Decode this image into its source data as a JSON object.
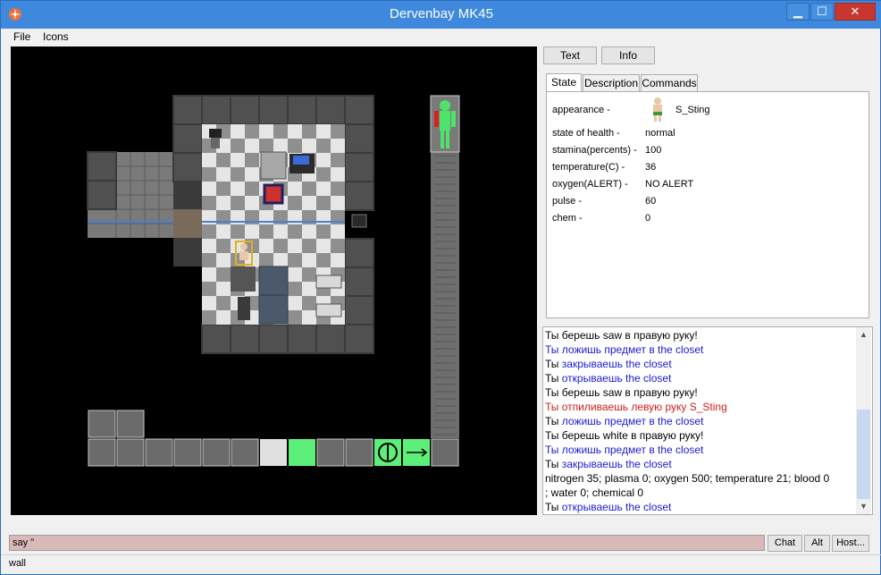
{
  "window": {
    "title": "Dervenbay MK45"
  },
  "menu": {
    "file": "File",
    "icons": "Icons"
  },
  "buttons": {
    "text": "Text",
    "info": "Info"
  },
  "tabs": [
    "State",
    "Description",
    "Commands"
  ],
  "state": {
    "rows": [
      {
        "label": "appearance -",
        "value": "S_Sting"
      },
      {
        "label": "state of health -",
        "value": "normal"
      },
      {
        "label": "stamina(percents) -",
        "value": "100"
      },
      {
        "label": "temperature(C) -",
        "value": "36"
      },
      {
        "label": "oxygen(ALERT) -",
        "value": "NO ALERT"
      },
      {
        "label": "pulse -",
        "value": "60"
      },
      {
        "label": "chem -",
        "value": "0"
      }
    ]
  },
  "chat": {
    "lines": [
      {
        "prefix": "Ты",
        "text": " берешь saw в правую руку!",
        "color": "#000000"
      },
      {
        "prefix": "",
        "text": "Ты ложишь предмет в the closet",
        "color": "#1a1ad6"
      },
      {
        "prefix": "Ты",
        "text": " закрываешь the closet",
        "color": "#1a1ad6"
      },
      {
        "prefix": "Ты",
        "text": " открываешь the closet",
        "color": "#1a1ad6"
      },
      {
        "prefix": "Ты",
        "text": " берешь saw в правую руку!",
        "color": "#000000"
      },
      {
        "prefix": "",
        "text": "Ты отпиливаешь левую руку S_Sting",
        "color": "#d61a1a"
      },
      {
        "prefix": "Ты",
        "text": " ложишь предмет в the closet",
        "color": "#1a1ad6"
      },
      {
        "prefix": "Ты",
        "text": " берешь white в правую руку!",
        "color": "#000000"
      },
      {
        "prefix": "",
        "text": "Ты ложишь предмет в the closet",
        "color": "#1a1ad6"
      },
      {
        "prefix": "Ты",
        "text": " закрываешь the closet",
        "color": "#1a1ad6"
      },
      {
        "prefix": "",
        "text": "nitrogen 35; plasma 0; oxygen 500; temperature 21; blood 0",
        "color": "#000000"
      },
      {
        "prefix": "",
        "text": "; water 0; chemical 0",
        "color": "#000000"
      },
      {
        "prefix": "Ты",
        "text": " открываешь the closet",
        "color": "#1a1ad6"
      }
    ]
  },
  "command": {
    "value": "say \""
  },
  "cmd_buttons": {
    "chat": "Chat",
    "alt": "Alt",
    "host": "Host..."
  },
  "status": {
    "text": "wall"
  }
}
